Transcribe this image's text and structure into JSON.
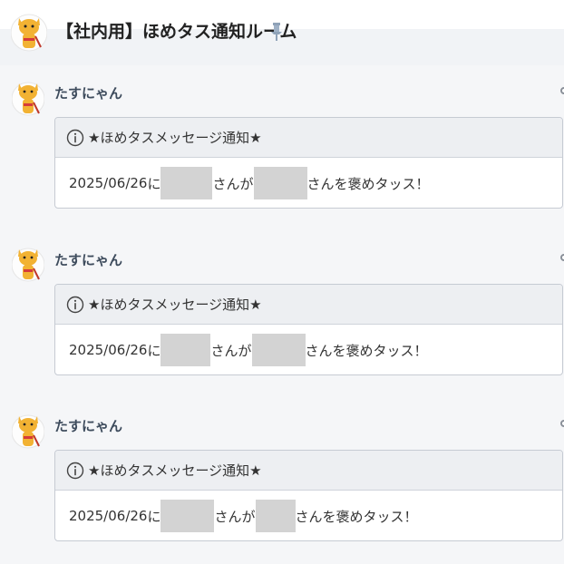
{
  "header": {
    "title": "【社内用】ほめタス通知ルーム"
  },
  "messages": [
    {
      "sender": "たすにゃん",
      "card_title": "★ほめタスメッセージ通知★",
      "date": "2025/06/26",
      "particle_ni": "に",
      "text_mid": "さんが",
      "text_end": "さんを褒めタッス！"
    },
    {
      "sender": "たすにゃん",
      "card_title": "★ほめタスメッセージ通知★",
      "date": "2025/06/26",
      "particle_ni": "に",
      "text_mid": "さんが",
      "text_end": "さんを褒めタッス！"
    },
    {
      "sender": "たすにゃん",
      "card_title": "★ほめタスメッセージ通知★",
      "date": "2025/06/26",
      "particle_ni": "に",
      "text_mid": "さんが",
      "text_end": "さんを褒めタッス！"
    }
  ],
  "colors": {
    "page_bg": "#f5f6f8",
    "card_header_bg": "#edeff2",
    "redaction": "#d3d3d3",
    "sender_text": "#3d4b5c"
  },
  "icons": {
    "room_avatar": "cat-mascot-icon",
    "pin": "pin-icon",
    "info": "info-circle-icon",
    "message_avatar": "cat-mascot-icon"
  }
}
